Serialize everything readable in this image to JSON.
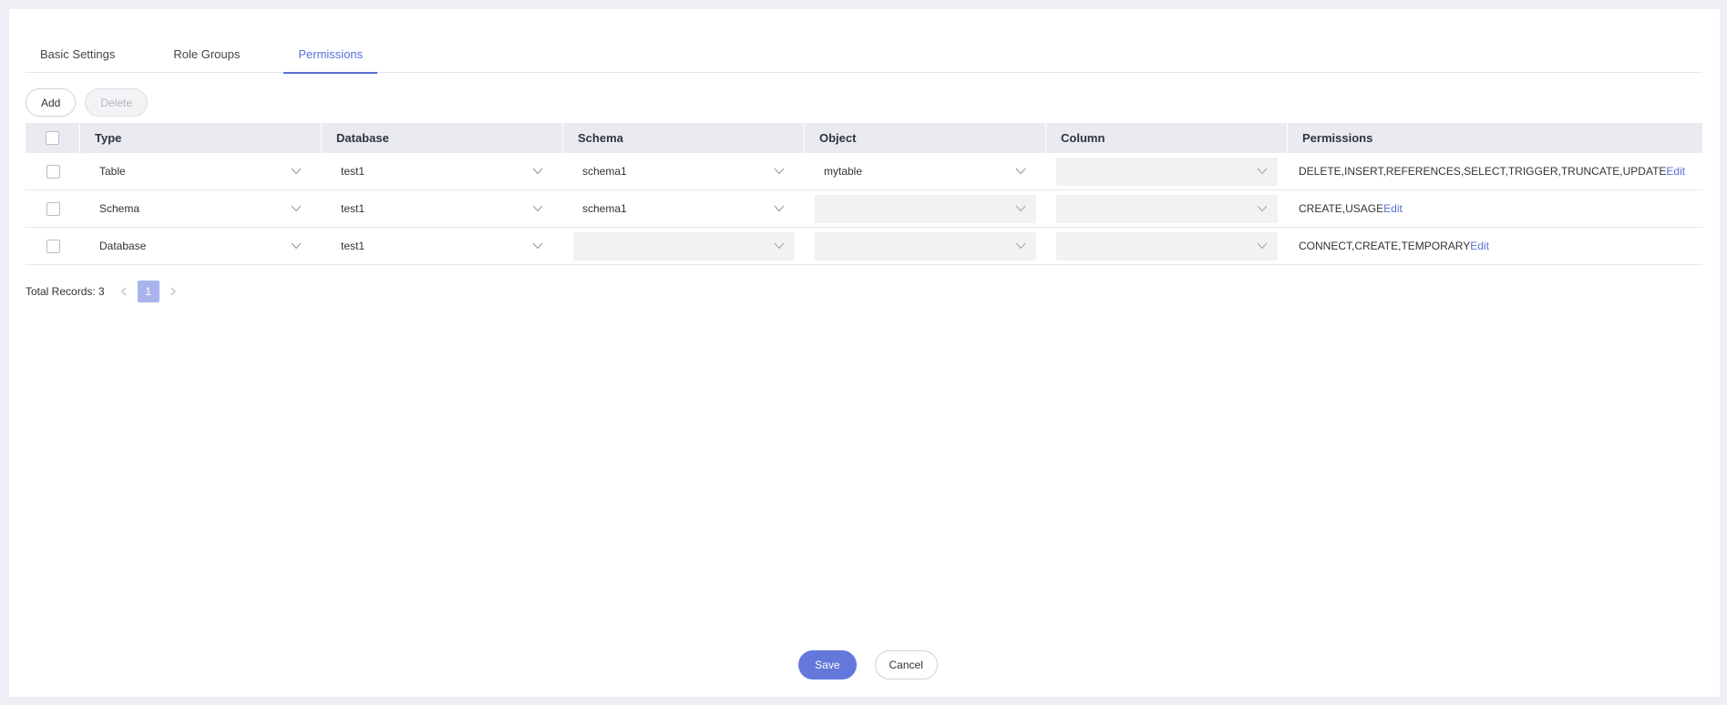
{
  "tabs": [
    {
      "label": "Basic Settings",
      "active": false
    },
    {
      "label": "Role Groups",
      "active": false
    },
    {
      "label": "Permissions",
      "active": true
    }
  ],
  "toolbar": {
    "add_label": "Add",
    "delete_label": "Delete"
  },
  "table": {
    "columns": [
      "Type",
      "Database",
      "Schema",
      "Object",
      "Column",
      "Permissions"
    ],
    "rows": [
      {
        "type": "Table",
        "database": "test1",
        "schema": "schema1",
        "object": "mytable",
        "column": "",
        "permissions": "DELETE,INSERT,REFERENCES,SELECT,TRIGGER,TRUNCATE,UPDATE",
        "edit": "Edit"
      },
      {
        "type": "Schema",
        "database": "test1",
        "schema": "schema1",
        "object": "",
        "column": "",
        "permissions": "CREATE,USAGE",
        "edit": "Edit"
      },
      {
        "type": "Database",
        "database": "test1",
        "schema": "",
        "object": "",
        "column": "",
        "permissions": "CONNECT,CREATE,TEMPORARY",
        "edit": "Edit"
      }
    ]
  },
  "pagination": {
    "total_label": "Total Records: 3",
    "current_page": "1"
  },
  "footer": {
    "save_label": "Save",
    "cancel_label": "Cancel"
  },
  "colors": {
    "accent": "#5b6fd6",
    "primary_button": "#6478dc",
    "page_active": "#a9b4ec"
  },
  "icons": {
    "dropdown": "chevron-down-icon",
    "prev": "chevron-left-icon",
    "next": "chevron-right-icon"
  }
}
